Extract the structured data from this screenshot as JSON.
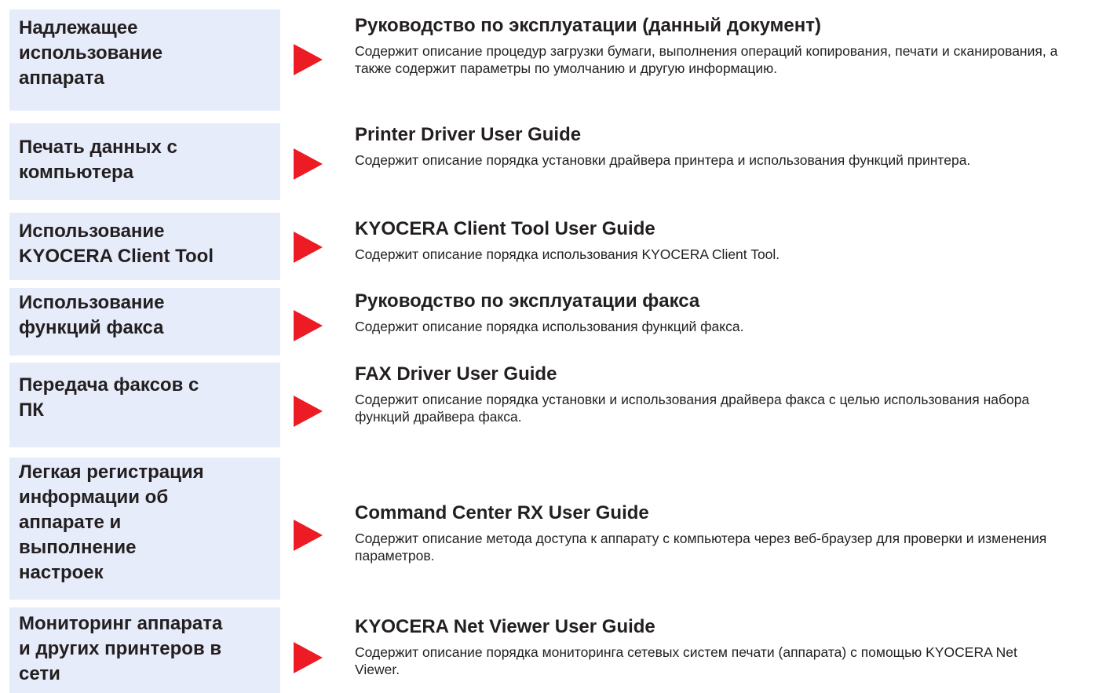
{
  "rows": [
    {
      "task": "Надлежащее\nиспользование\nаппарата",
      "guide_title": "Руководство по эксплуатации (данный документ)",
      "guide_desc": "Содержит описание процедур загрузки бумаги, выполнения операций копирования, печати и сканирования, а также содержит параметры по умолчанию и другую информацию."
    },
    {
      "task": "Печать данных с\nкомпьютера",
      "guide_title": "Printer Driver User Guide",
      "guide_desc": "Содержит описание порядка установки драйвера принтера и использования функций принтера."
    },
    {
      "task": "Использование\nKYOCERA Client Tool",
      "guide_title": "KYOCERA Client Tool User Guide",
      "guide_desc": "Содержит описание порядка использования KYOCERA Client Tool."
    },
    {
      "task": "Использование\nфункций факса",
      "guide_title": "Руководство по эксплуатации факса",
      "guide_desc": "Содержит описание порядка использования функций факса."
    },
    {
      "task": "Передача факсов с\nПК",
      "guide_title": "FAX Driver User Guide",
      "guide_desc": "Содержит описание порядка установки и использования драйвера факса с целью использования набора функций драйвера факса."
    },
    {
      "task": "Легкая регистрация\nинформации об\nаппарате и\nвыполнение\nнастроек",
      "guide_title": "Command Center RX User Guide",
      "guide_desc": "Содержит описание метода доступа к аппарату с компьютера через веб-браузер для проверки и изменения параметров."
    },
    {
      "task": "Мониторинг аппарата\nи других принтеров в\nсети",
      "guide_title": "KYOCERA Net Viewer User Guide",
      "guide_desc": "Содержит описание порядка мониторинга сетевых систем печати (аппарата) с помощью KYOCERA Net Viewer."
    }
  ],
  "colors": {
    "label_background": "#e7ecfa",
    "arrow": "#ec1b24",
    "text": "#231f20"
  },
  "icons": {
    "arrow": "right-triangle-arrow-icon"
  }
}
